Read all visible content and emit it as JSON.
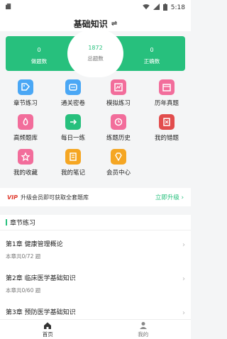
{
  "status": {
    "time": "5:18"
  },
  "header": {
    "title": "基础知识",
    "switch_icon": "swap-icon"
  },
  "stats": {
    "done": {
      "value": "0",
      "label": "做题数"
    },
    "total": {
      "value": "1872",
      "label": "总题数"
    },
    "correct": {
      "value": "0",
      "label": "正确数"
    }
  },
  "grid": {
    "items": [
      {
        "label": "章节练习",
        "icon": "tag-icon",
        "color": "#4aa7f5"
      },
      {
        "label": "通关密卷",
        "icon": "scroll-icon",
        "color": "#4aa7f5"
      },
      {
        "label": "模拟练习",
        "icon": "chart-icon",
        "color": "#f26d9b"
      },
      {
        "label": "历年真题",
        "icon": "calendar-icon",
        "color": "#f26d9b"
      },
      {
        "label": "高频题库",
        "icon": "flame-icon",
        "color": "#f26d9b"
      },
      {
        "label": "每日一练",
        "icon": "arrow-icon",
        "color": "#27c07d"
      },
      {
        "label": "练题历史",
        "icon": "history-icon",
        "color": "#f26d9b"
      },
      {
        "label": "我的错题",
        "icon": "mistake-icon",
        "color": "#e24d4d"
      },
      {
        "label": "我的收藏",
        "icon": "star-icon",
        "color": "#f26d9b"
      },
      {
        "label": "我的笔记",
        "icon": "note-icon",
        "color": "#f5a623"
      },
      {
        "label": "会员中心",
        "icon": "diamond-icon",
        "color": "#f5a623"
      }
    ]
  },
  "vip": {
    "tag": "VIP",
    "text": "升级会员即可获取全套题库",
    "button": "立即升级",
    "arrow": "›"
  },
  "section": {
    "title": "章节练习",
    "chapters": [
      {
        "title": "第1章 健康管理概论",
        "progress": "本章共0/72  题"
      },
      {
        "title": "第2章 临床医学基础知识",
        "progress": "本章共0/60  题"
      },
      {
        "title": "第3章 预防医学基础知识",
        "progress": ""
      }
    ]
  },
  "tabs": [
    {
      "label": "首页",
      "icon": "home-icon",
      "active": true
    },
    {
      "label": "我的",
      "icon": "person-icon",
      "active": false
    }
  ],
  "colors": {
    "accent": "#27c07d",
    "vip_red": "#e03b2e"
  }
}
